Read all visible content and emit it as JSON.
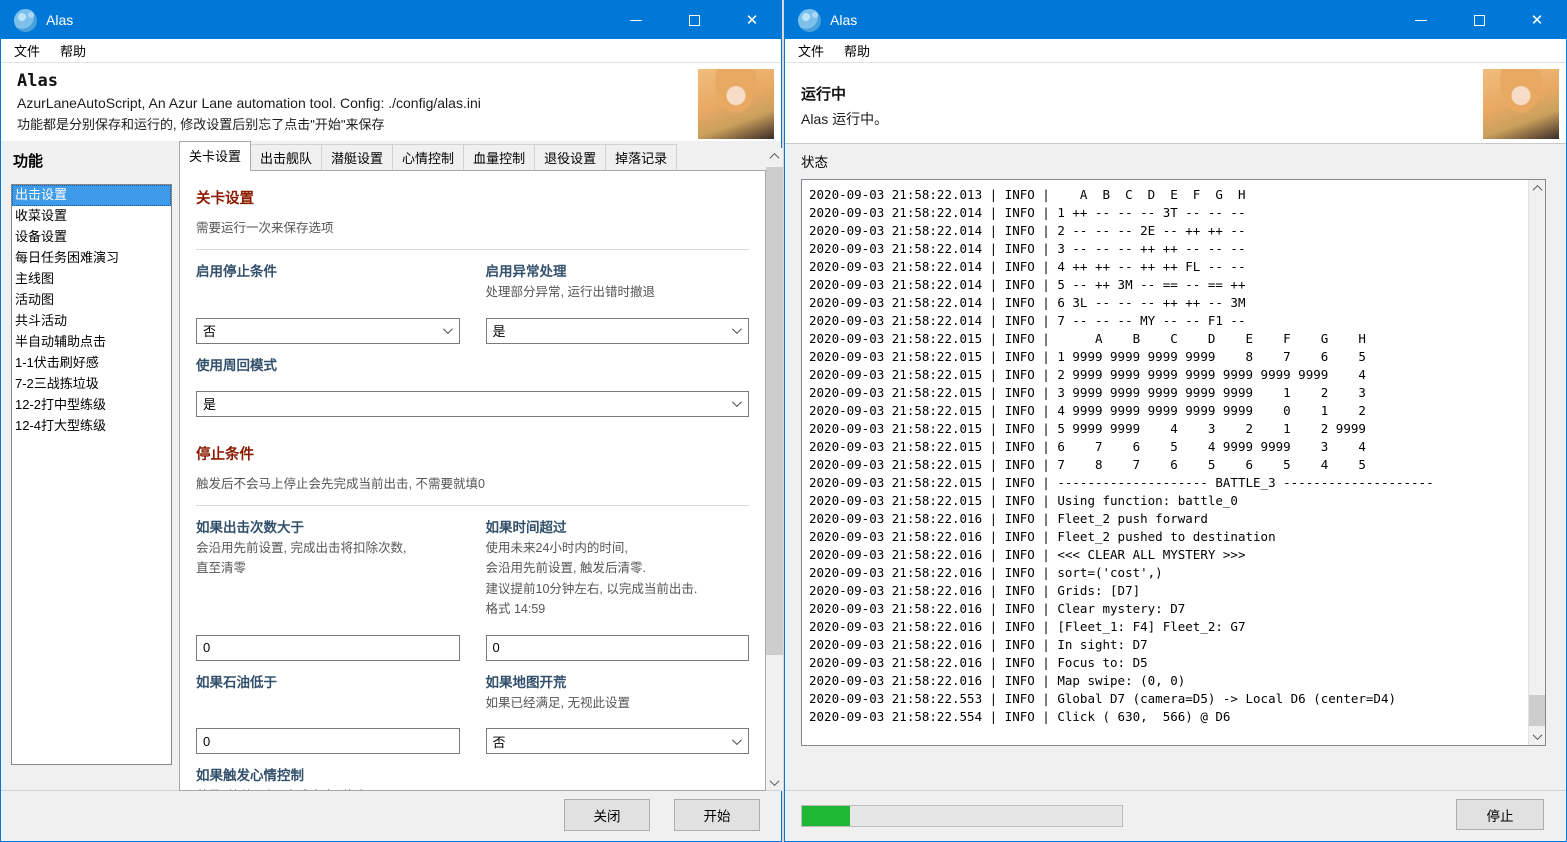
{
  "colors": {
    "titlebar_blue": "#0078d7",
    "selection_blue": "#3d9be9",
    "section_red": "#8b1a00",
    "label_navy": "#33506b",
    "progress_green": "#1fb834"
  },
  "left_window": {
    "titlebar": {
      "title": "Alas"
    },
    "menu": {
      "items": [
        "文件",
        "帮助"
      ]
    },
    "header": {
      "app_name": "Alas",
      "description": "AzurLaneAutoScript, An Azur Lane automation tool. Config: ./config/alas.ini",
      "hint": "功能都是分别保存和运行的, 修改设置后别忘了点击\"开始\"来保存"
    },
    "sidebar": {
      "heading": "功能",
      "selected": "出击设置",
      "items": [
        "出击设置",
        "收菜设置",
        "设备设置",
        "每日任务困难演习",
        "主线图",
        "活动图",
        "共斗活动",
        "半自动辅助点击",
        "1-1伏击刷好感",
        "7-2三战拣垃圾",
        "12-2打中型练级",
        "12-4打大型练级"
      ]
    },
    "tabs": {
      "active": "关卡设置",
      "items": [
        "关卡设置",
        "出击舰队",
        "潜艇设置",
        "心情控制",
        "血量控制",
        "退役设置",
        "掉落记录"
      ]
    },
    "form": {
      "sections": [
        {
          "title": "关卡设置",
          "subtitle": "需要运行一次来保存选项",
          "rows": [
            {
              "cells": [
                {
                  "label": "启用停止条件",
                  "help": [],
                  "control": "select",
                  "value": "否"
                },
                {
                  "label": "启用异常处理",
                  "help": [
                    "处理部分异常, 运行出错时撤退"
                  ],
                  "control": "select",
                  "value": "是"
                }
              ]
            },
            {
              "cells": [
                {
                  "label": "使用周回模式",
                  "help": [],
                  "control": "select",
                  "value": "是",
                  "span": 2
                }
              ]
            }
          ]
        },
        {
          "title": "停止条件",
          "subtitle": "触发后不会马上停止会先完成当前出击, 不需要就填0",
          "rows": [
            {
              "cells": [
                {
                  "label": "如果出击次数大于",
                  "help": [
                    "会沿用先前设置, 完成出击将扣除次数,",
                    "直至清零"
                  ],
                  "control": "input",
                  "value": "0"
                },
                {
                  "label": "如果时间超过",
                  "help": [
                    "使用未来24小时内的时间,",
                    "会沿用先前设置, 触发后清零.",
                    "建议提前10分钟左右, 以完成当前出击.",
                    "格式 14:59"
                  ],
                  "control": "input",
                  "value": "0"
                }
              ]
            },
            {
              "cells": [
                {
                  "label": "如果石油低于",
                  "help": [],
                  "control": "input",
                  "value": "0"
                },
                {
                  "label": "如果地图开荒",
                  "help": [
                    "如果已经满足, 无视此设置"
                  ],
                  "control": "select",
                  "value": "否"
                }
              ]
            },
            {
              "cells": [
                {
                  "label": "如果触发心情控制",
                  "help": [
                    "若是, 等待回复, 完成本次, 停止"
                  ],
                  "control": null,
                  "value": null,
                  "span": 2
                }
              ]
            }
          ]
        }
      ]
    },
    "footer": {
      "close_label": "关闭",
      "start_label": "开始"
    }
  },
  "right_window": {
    "titlebar": {
      "title": "Alas"
    },
    "menu": {
      "items": [
        "文件",
        "帮助"
      ]
    },
    "header": {
      "status_title": "运行中",
      "status_text": "Alas 运行中。"
    },
    "log": {
      "label": "状态",
      "lines": [
        "2020-09-03 21:58:22.013 | INFO |    A  B  C  D  E  F  G  H",
        "2020-09-03 21:58:22.014 | INFO | 1 ++ -- -- -- 3T -- -- --",
        "2020-09-03 21:58:22.014 | INFO | 2 -- -- -- 2E -- ++ ++ --",
        "2020-09-03 21:58:22.014 | INFO | 3 -- -- -- ++ ++ -- -- --",
        "2020-09-03 21:58:22.014 | INFO | 4 ++ ++ -- ++ ++ FL -- --",
        "2020-09-03 21:58:22.014 | INFO | 5 -- ++ 3M -- == -- == ++",
        "2020-09-03 21:58:22.014 | INFO | 6 3L -- -- -- ++ ++ -- 3M",
        "2020-09-03 21:58:22.014 | INFO | 7 -- -- -- MY -- -- F1 --",
        "2020-09-03 21:58:22.015 | INFO |      A    B    C    D    E    F    G    H",
        "2020-09-03 21:58:22.015 | INFO | 1 9999 9999 9999 9999    8    7    6    5",
        "2020-09-03 21:58:22.015 | INFO | 2 9999 9999 9999 9999 9999 9999 9999    4",
        "2020-09-03 21:58:22.015 | INFO | 3 9999 9999 9999 9999 9999    1    2    3",
        "2020-09-03 21:58:22.015 | INFO | 4 9999 9999 9999 9999 9999    0    1    2",
        "2020-09-03 21:58:22.015 | INFO | 5 9999 9999    4    3    2    1    2 9999",
        "2020-09-03 21:58:22.015 | INFO | 6    7    6    5    4 9999 9999    3    4",
        "2020-09-03 21:58:22.015 | INFO | 7    8    7    6    5    6    5    4    5",
        "2020-09-03 21:58:22.015 | INFO | -------------------- BATTLE_3 --------------------",
        "2020-09-03 21:58:22.015 | INFO | Using function: battle_0",
        "2020-09-03 21:58:22.016 | INFO | Fleet_2 push forward",
        "2020-09-03 21:58:22.016 | INFO | Fleet_2 pushed to destination",
        "2020-09-03 21:58:22.016 | INFO | <<< CLEAR ALL MYSTERY >>>",
        "2020-09-03 21:58:22.016 | INFO | sort=('cost',)",
        "2020-09-03 21:58:22.016 | INFO | Grids: [D7]",
        "2020-09-03 21:58:22.016 | INFO | Clear mystery: D7",
        "2020-09-03 21:58:22.016 | INFO | [Fleet_1: F4] Fleet_2: G7",
        "2020-09-03 21:58:22.016 | INFO | In sight: D7",
        "2020-09-03 21:58:22.016 | INFO | Focus to: D5",
        "2020-09-03 21:58:22.016 | INFO | Map swipe: (0, 0)",
        "2020-09-03 21:58:22.553 | INFO | Global D7 (camera=D5) -> Local D6 (center=D4)",
        "2020-09-03 21:58:22.554 | INFO | Click ( 630,  566) @ D6"
      ]
    },
    "footer": {
      "progress_percent": 15,
      "stop_label": "停止"
    }
  }
}
